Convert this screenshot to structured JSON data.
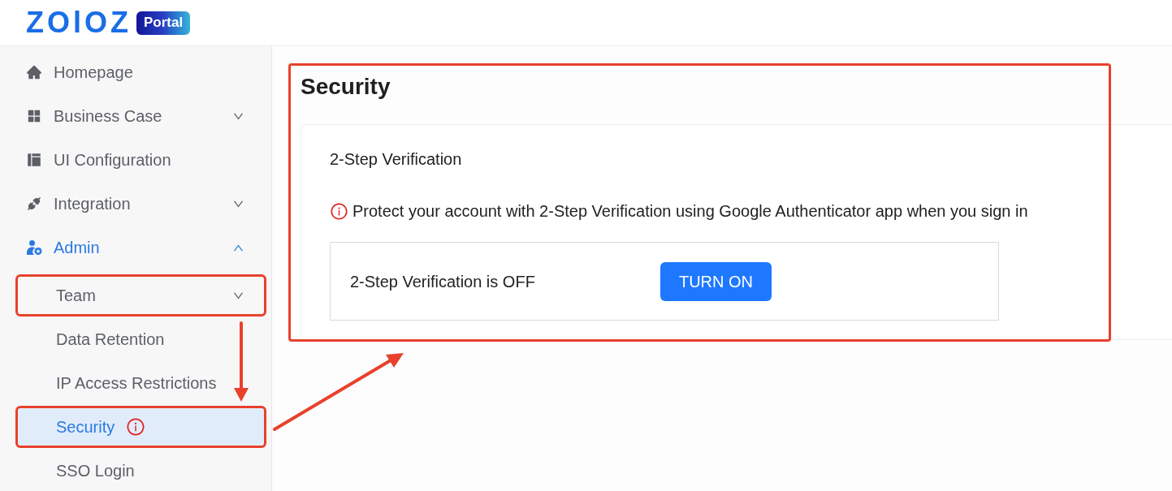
{
  "header": {
    "logo": "ZOlOZ",
    "badge": "Portal"
  },
  "sidebar": {
    "items": [
      {
        "label": "Homepage",
        "selected": false,
        "highlighted": false,
        "alert": false
      },
      {
        "label": "Business Case",
        "selected": false,
        "expanded": false,
        "highlighted": false,
        "alert": false
      },
      {
        "label": "UI Configuration",
        "selected": false,
        "highlighted": false,
        "alert": false
      },
      {
        "label": "Integration",
        "selected": false,
        "expanded": false,
        "highlighted": false,
        "alert": false
      },
      {
        "label": "Admin",
        "selected": false,
        "expanded": true,
        "highlighted": false,
        "alert": false,
        "children": [
          {
            "label": "Team",
            "selected": false,
            "expanded": false,
            "highlighted": true,
            "alert": false
          },
          {
            "label": "Data Retention",
            "selected": false,
            "highlighted": false,
            "alert": false
          },
          {
            "label": "IP Access Restrictions",
            "selected": false,
            "highlighted": false,
            "alert": false
          },
          {
            "label": "Security",
            "selected": true,
            "highlighted": true,
            "alert": true
          },
          {
            "label": "SSO Login",
            "selected": false,
            "highlighted": false,
            "alert": false
          }
        ]
      }
    ]
  },
  "main": {
    "title": "Security",
    "highlighted": true,
    "card": {
      "title": "2-Step Verification",
      "notice": "Protect your account with 2-Step Verification using Google Authenticator app when you sign in",
      "status": "2-Step Verification is OFF",
      "button": "TURN ON"
    }
  }
}
